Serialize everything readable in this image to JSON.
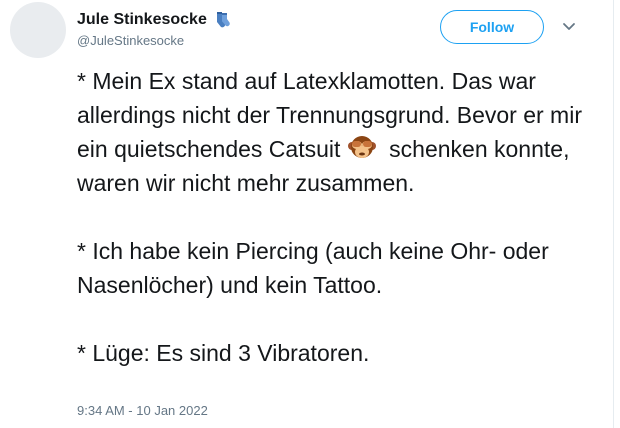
{
  "author": {
    "display_name": "Jule Stinkesocke",
    "handle": "@JuleStinkesocke",
    "name_emoji": "socks-icon"
  },
  "actions": {
    "follow_label": "Follow",
    "menu_icon": "chevron-down-icon"
  },
  "tweet": {
    "para1_before": "* Mein Ex stand auf Latexklamotten. Das war allerdings nicht der Trennungsgrund. Bevor er mir ein quietschendes Catsuit",
    "inline_emoji": "see-no-evil-monkey-icon",
    "para1_after": "schenken konnte, waren wir nicht mehr zusammen.",
    "para2": "* Ich habe kein Piercing (auch keine Ohr- oder Nasenlöcher) und kein Tattoo.",
    "para3": "* Lüge: Es sind 3 Vibratoren."
  },
  "meta": {
    "timestamp": "9:34 AM - 10 Jan 2022"
  },
  "colors": {
    "accent": "#1da1f2",
    "text": "#14171a",
    "secondary": "#657786"
  }
}
